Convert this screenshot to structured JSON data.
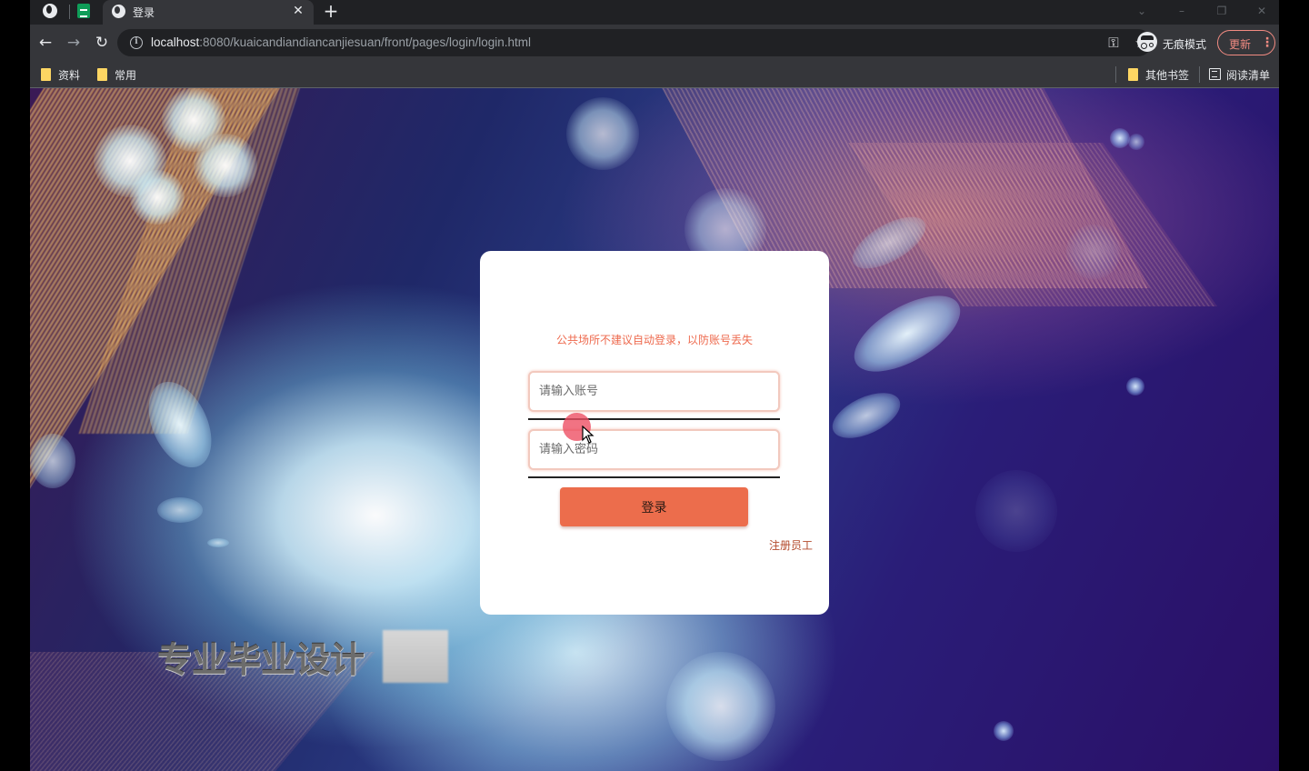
{
  "browser": {
    "tab": {
      "title": "登录"
    },
    "address_bar": {
      "url_host": "localhost",
      "url_rest": ":8080/kuaicandiandiancanjiesuan/front/pages/login/login.html"
    },
    "profile": {
      "label": "无痕模式"
    },
    "update": {
      "label": "更新"
    },
    "bookmarks": {
      "left": [
        "资料",
        "常用"
      ],
      "other": "其他书签",
      "reading_list": "阅读清单"
    }
  },
  "login": {
    "notice": "公共场所不建议自动登录，以防账号丢失",
    "username_placeholder": "请输入账号",
    "password_placeholder": "请输入密码",
    "submit_label": "登录",
    "register_link": "注册员工"
  },
  "watermark": {
    "text": "专业毕业设计"
  },
  "colors": {
    "accent": "#ec6d4c",
    "notice": "#ee6a4e",
    "register": "#b34a2c",
    "update": "#f28b82"
  }
}
